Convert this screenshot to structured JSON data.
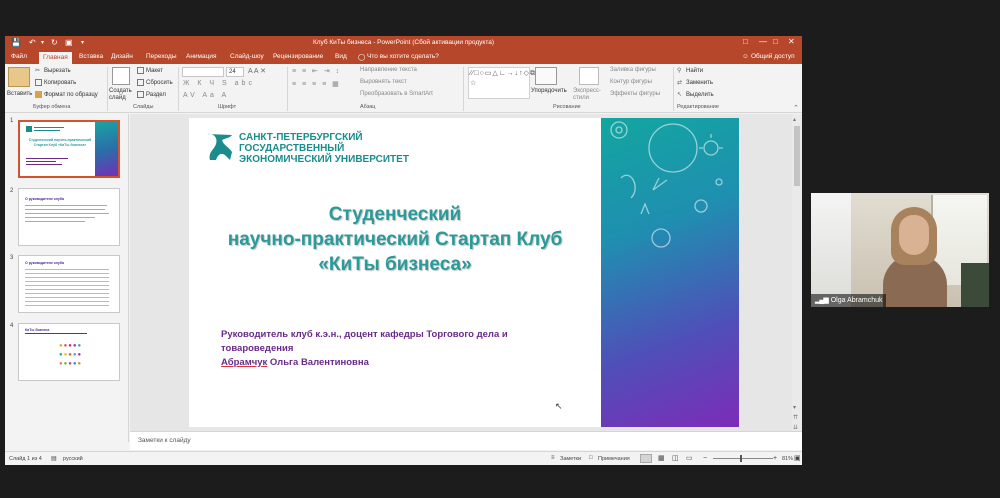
{
  "titlebar": {
    "title": "Клуб КиТы бизнеса - PowerPoint (Сбой активации продукта)"
  },
  "tabs": [
    "Файл",
    "Главная",
    "Вставка",
    "Дизайн",
    "Переходы",
    "Анимация",
    "Слайд-шоу",
    "Рецензирование",
    "Вид"
  ],
  "tellme": "Что вы хотите сделать?",
  "share": "Общий доступ",
  "ribbon": {
    "paste": "Вставить",
    "cut": "Вырезать",
    "copy": "Копировать",
    "format_painter": "Формат по образцу",
    "group_clipboard": "Буфер обмена",
    "new_slide": "Создать слайд",
    "layout": "Макет",
    "reset": "Сбросить",
    "section": "Раздел",
    "group_slides": "Слайды",
    "font_size": "24",
    "group_font": "Шрифт",
    "text_direction": "Направление текста",
    "align_text": "Выровнять текст",
    "smartart": "Преобразовать в SmartArt",
    "group_paragraph": "Абзац",
    "arrange": "Упорядочить",
    "quick_styles": "Экспресс-стили",
    "shape_fill": "Заливка фигуры",
    "shape_outline": "Контур фигуры",
    "shape_effects": "Эффекты фигуры",
    "group_drawing": "Рисование",
    "find": "Найти",
    "replace": "Заменить",
    "select": "Выделить",
    "group_editing": "Редактирование"
  },
  "thumbnails": [
    {
      "num": "1",
      "title": "Студенческий научно-практический Стартап Клуб «КиТы бизнеса»"
    },
    {
      "num": "2",
      "title": "О руководителе клуба"
    },
    {
      "num": "3",
      "title": "О руководителе клуба"
    },
    {
      "num": "4",
      "title": "КиТы бизнеса"
    }
  ],
  "slide": {
    "logo_line1": "САНКТ-ПЕТЕРБУРГСКИЙ",
    "logo_line2": "ГОСУДАРСТВЕННЫЙ",
    "logo_line3": "ЭКОНОМИЧЕСКИЙ УНИВЕРСИТЕТ",
    "title_line1": "Студенческий",
    "title_line2": "научно-практический Стартап Клуб",
    "title_line3": "«КиТы бизнеса»",
    "leader_line1": "Руководитель клуб к.э.н., доцент кафедры Торгового дела и",
    "leader_line2": "товароведения",
    "leader_surname": "Абрамчук",
    "leader_name": " Ольга Валентиновна"
  },
  "notes": "Заметки к слайду",
  "status": {
    "slide_info": "Слайд 1 из 4",
    "language": "русский",
    "notes_btn": "Заметки",
    "comments_btn": "Примечания",
    "zoom": "81%"
  },
  "video": {
    "participant": "Olga Abramchuk"
  },
  "colors": {
    "ppt_accent": "#b7472a",
    "logo_teal": "#1a8c8c",
    "title_teal": "#2a9a9a",
    "purple_text": "#6a2a8a"
  }
}
